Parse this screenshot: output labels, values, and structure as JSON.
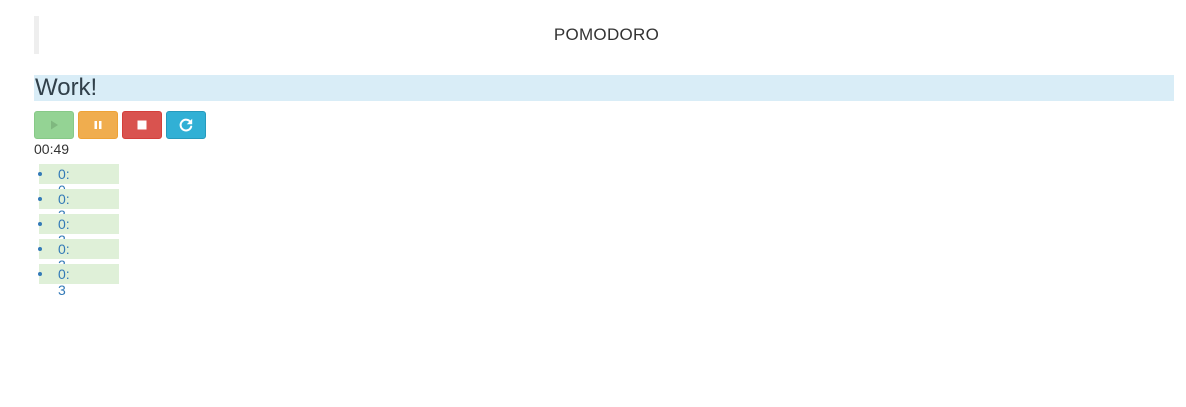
{
  "app": {
    "title": "POMODORO"
  },
  "phase": {
    "label": "Work!"
  },
  "controls": {
    "play": {
      "icon": "play-icon",
      "state": "disabled"
    },
    "pause": {
      "icon": "pause-icon"
    },
    "stop": {
      "icon": "stop-icon"
    },
    "reset": {
      "icon": "refresh-icon"
    }
  },
  "timer": {
    "value": "00:49"
  },
  "sessions": [
    {
      "label": "0: 0"
    },
    {
      "label": "0: 3"
    },
    {
      "label": "0: 2"
    },
    {
      "label": "0: 2"
    },
    {
      "label": "0: 3"
    }
  ],
  "colors": {
    "phase_banner": "#d9edf7",
    "play": "#94d394",
    "pause": "#f0ad4e",
    "stop": "#d9534f",
    "reset": "#31b0d5",
    "session_bg": "#dff0d8",
    "session_text": "#337ab7"
  }
}
